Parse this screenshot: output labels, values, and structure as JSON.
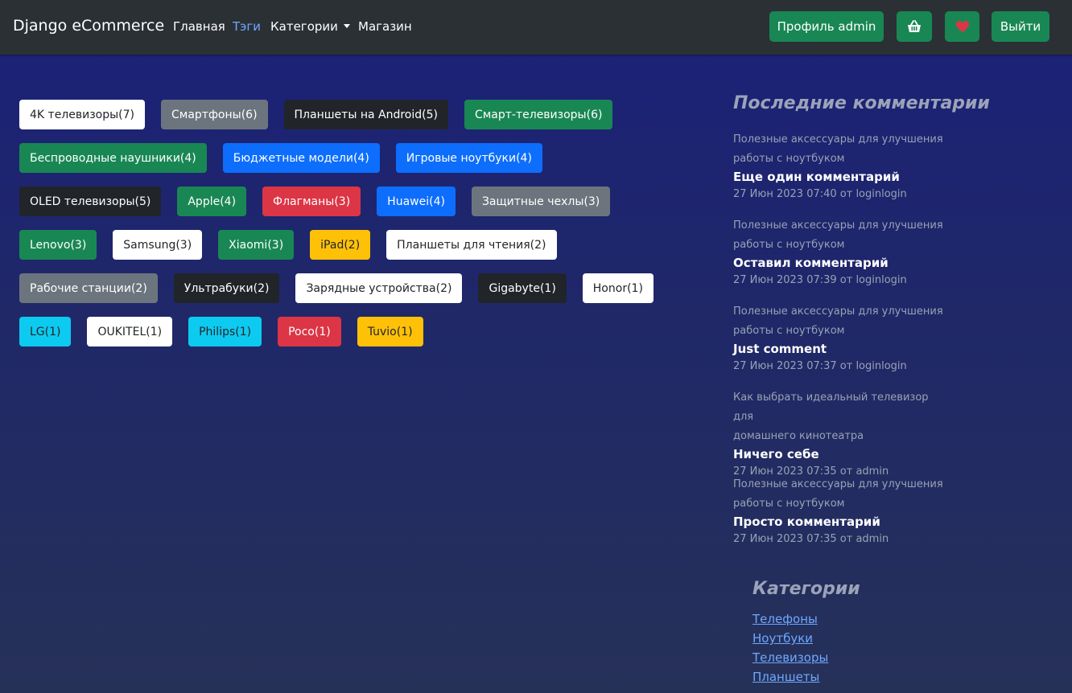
{
  "navbar": {
    "brand": "Django eCommerce",
    "links": [
      "Главная",
      "Тэги",
      "Категории",
      "Магазин"
    ],
    "profile_button": "Профиль admin",
    "cart_icon": "basket-icon",
    "wishlist_icon": "heart-icon",
    "logout_button": "Выйти"
  },
  "tags": [
    [
      {
        "label": "4K телевизоры(7)",
        "style": "light"
      },
      {
        "label": "Смартфоны(6)",
        "style": "secondary"
      },
      {
        "label": "Планшеты на Android(5)",
        "style": "dark"
      },
      {
        "label": "Смарт-телевизоры(6)",
        "style": "success"
      }
    ],
    [
      {
        "label": "Беспроводные наушники(4)",
        "style": "success"
      },
      {
        "label": "Бюджетные модели(4)",
        "style": "primary"
      },
      {
        "label": "Игровые ноутбуки(4)",
        "style": "primary"
      }
    ],
    [
      {
        "label": "OLED телевизоры(5)",
        "style": "dark"
      },
      {
        "label": "Apple(4)",
        "style": "success"
      },
      {
        "label": "Флагманы(3)",
        "style": "danger"
      },
      {
        "label": "Huawei(4)",
        "style": "primary"
      },
      {
        "label": "Защитные чехлы(3)",
        "style": "secondary"
      }
    ],
    [
      {
        "label": "Lenovo(3)",
        "style": "success"
      },
      {
        "label": "Samsung(3)",
        "style": "light"
      },
      {
        "label": "Xiaomi(3)",
        "style": "success"
      },
      {
        "label": "iPad(2)",
        "style": "warning"
      },
      {
        "label": "Планшеты для чтения(2)",
        "style": "light"
      }
    ],
    [
      {
        "label": "Рабочие станции(2)",
        "style": "secondary"
      },
      {
        "label": "Ультрабуки(2)",
        "style": "dark"
      },
      {
        "label": "Зарядные устройства(2)",
        "style": "light"
      },
      {
        "label": "Gigabyte(1)",
        "style": "dark"
      },
      {
        "label": "Honor(1)",
        "style": "light"
      }
    ],
    [
      {
        "label": "LG(1)",
        "style": "info"
      },
      {
        "label": "OUKITEL(1)",
        "style": "light"
      },
      {
        "label": "Philips(1)",
        "style": "info"
      },
      {
        "label": "Poco(1)",
        "style": "danger"
      },
      {
        "label": "Tuvio(1)",
        "style": "warning"
      }
    ]
  ],
  "sidebar": {
    "comments_title": "Последние комментарии",
    "comments": [
      {
        "post_line1": "Полезные аксессуары для улучшения",
        "post_line2": "работы с ноутбуком",
        "text": "Еще один комментарий",
        "meta": "27 Июн 2023 07:40 от loginlogin"
      },
      {
        "post_line1": "Полезные аксессуары для улучшения",
        "post_line2": "работы с ноутбуком",
        "text": "Оставил комментарий",
        "meta": "27 Июн 2023 07:39 от loginlogin"
      },
      {
        "post_line1": "Полезные аксессуары для улучшения",
        "post_line2": "работы с ноутбуком",
        "text": "Just comment",
        "meta": "27 Июн 2023 07:37 от loginlogin"
      },
      {
        "post_line1": "Как выбрать идеальный телевизор для",
        "post_line2": "домашнего кинотеатра",
        "text": "Ничего себе",
        "meta": "27 Июн 2023 07:35 от admin"
      },
      {
        "post_line1": "Полезные аксессуары для улучшения",
        "post_line2": "работы с ноутбуком",
        "text": "Просто комментарий",
        "meta": "27 Июн 2023 07:35 от admin"
      }
    ],
    "categories_title": "Категории",
    "categories": [
      "Телефоны",
      "Ноутбуки",
      "Телевизоры",
      "Планшеты"
    ]
  }
}
